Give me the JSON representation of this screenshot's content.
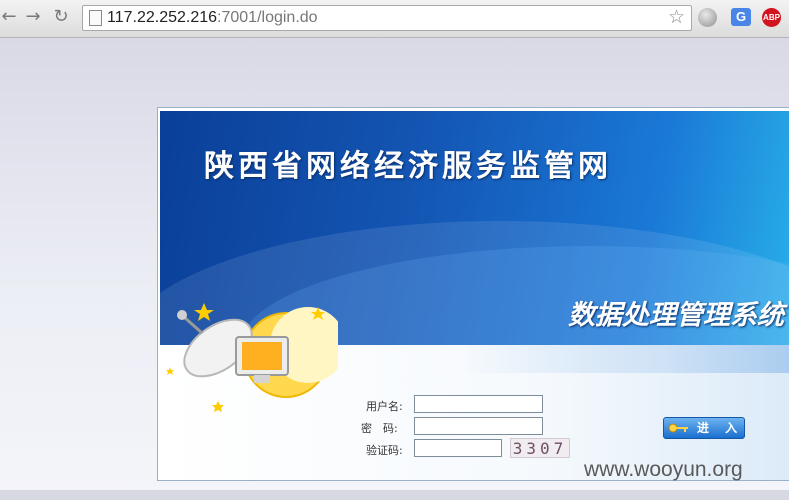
{
  "browser": {
    "url_host": "117.22.252.216",
    "url_path": ":7001/login.do",
    "back_icon": "back-arrow-icon",
    "forward_icon": "forward-arrow-icon",
    "reload_icon": "reload-icon",
    "bookmark_icon": "star-icon",
    "extensions": [
      "globe-icon",
      "translate-icon",
      "adblock-plus-icon"
    ],
    "translate_glyph": "G",
    "abp_text": "ABP"
  },
  "login": {
    "site_title": "陕西省网络经济服务监管网",
    "system_subtitle": "数据处理管理系统",
    "username_label": "用户名:",
    "password_label": "密　码:",
    "captcha_label": "验证码:",
    "captcha_code": "3307",
    "enter_label": "进 入"
  },
  "watermark": "www.wooyun.org",
  "colors": {
    "banner_dark": "#0a3f98",
    "banner_light": "#29b3ea",
    "button_blue": "#1a6fd0"
  }
}
